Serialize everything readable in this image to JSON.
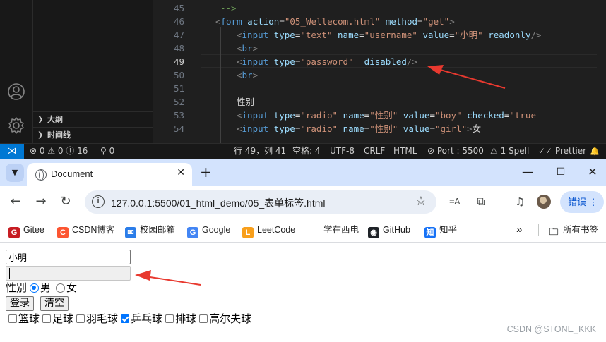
{
  "vscode": {
    "sidebar_sections": [
      {
        "label": "大纲"
      },
      {
        "label": "时间线"
      }
    ],
    "gutter": [
      "45",
      "46",
      "47",
      "48",
      "49",
      "50",
      "51",
      "52",
      "53",
      "54"
    ],
    "active_line": "49",
    "code_lines": [
      [
        {
          "t": "-->",
          "c": "cmt"
        }
      ],
      [
        {
          "t": "<",
          "c": "punc"
        },
        {
          "t": "form",
          "c": "tag"
        },
        {
          "t": " ",
          "c": "txt"
        },
        {
          "t": "action",
          "c": "attr"
        },
        {
          "t": "=",
          "c": "txt"
        },
        {
          "t": "\"05_Wellecom.html\"",
          "c": "str"
        },
        {
          "t": " ",
          "c": "txt"
        },
        {
          "t": "method",
          "c": "attr"
        },
        {
          "t": "=",
          "c": "txt"
        },
        {
          "t": "\"get\"",
          "c": "str"
        },
        {
          "t": ">",
          "c": "punc"
        }
      ],
      [
        {
          "t": "<",
          "c": "punc"
        },
        {
          "t": "input",
          "c": "tag"
        },
        {
          "t": " ",
          "c": "txt"
        },
        {
          "t": "type",
          "c": "attr"
        },
        {
          "t": "=",
          "c": "txt"
        },
        {
          "t": "\"text\"",
          "c": "str"
        },
        {
          "t": " ",
          "c": "txt"
        },
        {
          "t": "name",
          "c": "attr"
        },
        {
          "t": "=",
          "c": "txt"
        },
        {
          "t": "\"username\"",
          "c": "str"
        },
        {
          "t": " ",
          "c": "txt"
        },
        {
          "t": "value",
          "c": "attr"
        },
        {
          "t": "=",
          "c": "txt"
        },
        {
          "t": "\"小明\"",
          "c": "str"
        },
        {
          "t": " ",
          "c": "txt"
        },
        {
          "t": "readonly",
          "c": "attr"
        },
        {
          "t": "/>",
          "c": "punc"
        }
      ],
      [
        {
          "t": "<",
          "c": "punc"
        },
        {
          "t": "br",
          "c": "tag"
        },
        {
          "t": ">",
          "c": "punc"
        }
      ],
      [
        {
          "t": "<",
          "c": "punc"
        },
        {
          "t": "input",
          "c": "tag"
        },
        {
          "t": " ",
          "c": "txt"
        },
        {
          "t": "type",
          "c": "attr"
        },
        {
          "t": "=",
          "c": "txt"
        },
        {
          "t": "\"password\"",
          "c": "str"
        },
        {
          "t": "  ",
          "c": "txt"
        },
        {
          "t": "disabled",
          "c": "attr"
        },
        {
          "t": "/>",
          "c": "punc"
        }
      ],
      [
        {
          "t": "<",
          "c": "punc"
        },
        {
          "t": "br",
          "c": "tag"
        },
        {
          "t": ">",
          "c": "punc"
        }
      ],
      [],
      [
        {
          "t": "性别",
          "c": "txt"
        }
      ],
      [
        {
          "t": "<",
          "c": "punc"
        },
        {
          "t": "input",
          "c": "tag"
        },
        {
          "t": " ",
          "c": "txt"
        },
        {
          "t": "type",
          "c": "attr"
        },
        {
          "t": "=",
          "c": "txt"
        },
        {
          "t": "\"radio\"",
          "c": "str"
        },
        {
          "t": " ",
          "c": "txt"
        },
        {
          "t": "name",
          "c": "attr"
        },
        {
          "t": "=",
          "c": "txt"
        },
        {
          "t": "\"性别\"",
          "c": "str"
        },
        {
          "t": " ",
          "c": "txt"
        },
        {
          "t": "value",
          "c": "attr"
        },
        {
          "t": "=",
          "c": "txt"
        },
        {
          "t": "\"boy\"",
          "c": "str"
        },
        {
          "t": " ",
          "c": "txt"
        },
        {
          "t": "checked",
          "c": "attr"
        },
        {
          "t": "=",
          "c": "txt"
        },
        {
          "t": "\"true",
          "c": "str"
        }
      ],
      [
        {
          "t": "<",
          "c": "punc"
        },
        {
          "t": "input",
          "c": "tag"
        },
        {
          "t": " ",
          "c": "txt"
        },
        {
          "t": "type",
          "c": "attr"
        },
        {
          "t": "=",
          "c": "txt"
        },
        {
          "t": "\"radio\"",
          "c": "str"
        },
        {
          "t": " ",
          "c": "txt"
        },
        {
          "t": "name",
          "c": "attr"
        },
        {
          "t": "=",
          "c": "txt"
        },
        {
          "t": "\"性别\"",
          "c": "str"
        },
        {
          "t": " ",
          "c": "txt"
        },
        {
          "t": "value",
          "c": "attr"
        },
        {
          "t": "=",
          "c": "txt"
        },
        {
          "t": "\"girl\"",
          "c": "str"
        },
        {
          "t": ">",
          "c": "punc"
        },
        {
          "t": "女",
          "c": "txt"
        }
      ]
    ],
    "status": {
      "problems": "⊗ 0 ⚠ 0 ⓘ 16",
      "ports_forward": "⚲ 0",
      "cursor": "行 49，列 41",
      "spaces": "空格: 4",
      "encoding": "UTF-8",
      "eol": "CRLF",
      "language": "HTML",
      "port": "⊘ Port : 5500",
      "spell": "⚠ 1 Spell",
      "prettier": "✓✓ Prettier",
      "bell": "🔔"
    }
  },
  "browser": {
    "tab_title": "Document",
    "url": "127.0.0.1:5500/01_html_demo/05_表单标签.html",
    "profile_button": "错误",
    "bookmarks": [
      {
        "label": "Gitee",
        "icon": "G",
        "color": "#c71d23"
      },
      {
        "label": "CSDN博客",
        "icon": "C",
        "color": "#fc5531"
      },
      {
        "label": "校园邮箱",
        "icon": "✉",
        "color": "#2b7de9"
      },
      {
        "label": "Google",
        "icon": "G",
        "color": "#4285f4"
      },
      {
        "label": "LeetCode",
        "icon": "L",
        "color": "#f89f1b"
      },
      {
        "label": "学在西电",
        "icon": "",
        "color": ""
      },
      {
        "label": "GitHub",
        "icon": "◉",
        "color": "#1f2328"
      },
      {
        "label": "知乎",
        "icon": "知",
        "color": "#1772f6"
      }
    ],
    "overflow_label": "»",
    "all_bookmarks": "所有书签"
  },
  "page": {
    "username_value": "小明",
    "gender_label": "性别",
    "gender_options": [
      {
        "label": "男",
        "checked": true
      },
      {
        "label": "女",
        "checked": false
      }
    ],
    "login_button": "登录",
    "reset_button": "清空",
    "hobbies": [
      {
        "label": "篮球",
        "checked": false
      },
      {
        "label": "足球",
        "checked": false
      },
      {
        "label": "羽毛球",
        "checked": false
      },
      {
        "label": "乒乓球",
        "checked": true
      },
      {
        "label": "排球",
        "checked": false
      },
      {
        "label": "高尔夫球",
        "checked": false
      }
    ],
    "watermark": "CSDN @STONE_KKK"
  },
  "colors": {
    "vscode_accent": "#0078d4",
    "annotation_arrow": "#e8392f",
    "chrome_tabstrip": "#d3e3fd",
    "control_accent": "#0075ff"
  },
  "icons": [
    "account-icon",
    "settings-gear-icon",
    "remote-icon",
    "chrome-tab-search-icon",
    "globe-favicon-icon",
    "close-icon",
    "new-tab-icon",
    "minimize-icon",
    "maximize-icon",
    "window-close-icon",
    "back-icon",
    "forward-icon",
    "reload-icon",
    "site-info-icon",
    "star-icon",
    "translate-icon",
    "extensions-icon",
    "media-icon",
    "folder-icon"
  ]
}
